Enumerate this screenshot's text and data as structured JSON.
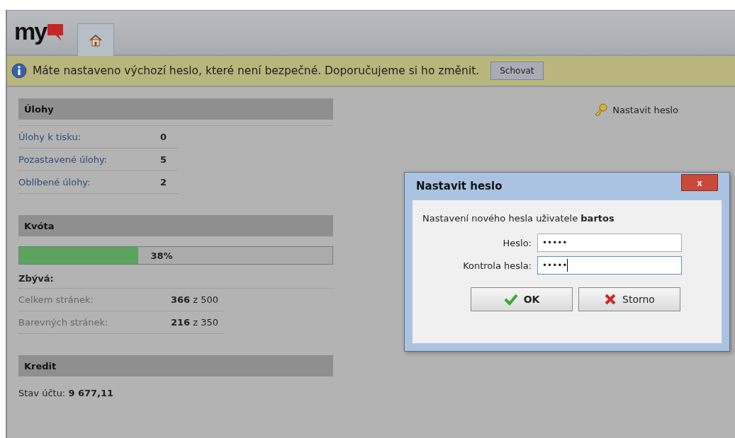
{
  "header": {
    "logo": "my"
  },
  "banner": {
    "message": "Máte nastaveno výchozí heslo, které není bezpečné. Doporučujeme si ho změnit.",
    "button": "Schovat"
  },
  "tasks": {
    "title": "Úlohy",
    "rows": [
      {
        "label": "Úlohy k tisku:",
        "value": "0"
      },
      {
        "label": "Pozastavené úlohy:",
        "value": "5"
      },
      {
        "label": "Oblíbené úlohy:",
        "value": "2"
      }
    ]
  },
  "quota": {
    "title": "Kvóta",
    "level": 0.38,
    "reading": "38%",
    "remaining_title": "Zbývá:",
    "rows": [
      {
        "label": "Celkem stránek:",
        "value": "**366** z 500"
      },
      {
        "label": "Barevných stránek:",
        "value": "**216** z 350"
      }
    ]
  },
  "credit": {
    "title": "Kredit",
    "text": "Stav účtu: **9 677,11**"
  },
  "set_password_link": "Nastavit heslo",
  "dialog": {
    "title": "Nastavit heslo",
    "close": "x",
    "message": "Nastavení nového hesla uživatele **bartos**",
    "fields": [
      {
        "label": "Heslo:",
        "value": "•••••",
        "focused": false
      },
      {
        "label": "Kontrola hesla:",
        "value": "•••••",
        "focused": true
      }
    ],
    "buttons": [
      {
        "kind": "ok",
        "label": "OK"
      },
      {
        "kind": "cancel",
        "label": "Storno"
      }
    ]
  }
}
